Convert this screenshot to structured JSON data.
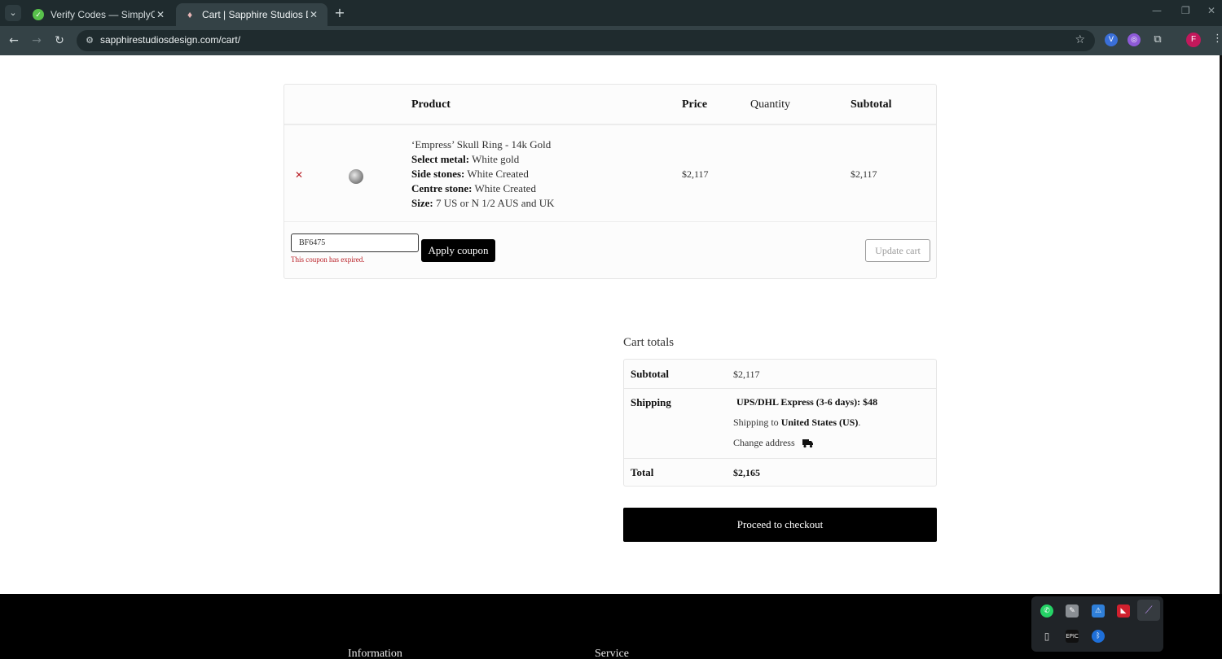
{
  "browser": {
    "tabs": [
      {
        "title": "Verify Codes — SimplyCodes",
        "active": false
      },
      {
        "title": "Cart | Sapphire Studios Design",
        "active": true
      }
    ],
    "url": "sapphirestudiosdesign.com/cart/",
    "profile_initial": "F"
  },
  "cart": {
    "headers": {
      "product": "Product",
      "price": "Price",
      "quantity": "Quantity",
      "subtotal": "Subtotal"
    },
    "item": {
      "name": "‘Empress’ Skull Ring - 14k Gold",
      "meta": [
        {
          "label": "Select metal:",
          "value": "White gold"
        },
        {
          "label": "Side stones:",
          "value": "White Created"
        },
        {
          "label": "Centre stone:",
          "value": "White Created"
        },
        {
          "label": "Size:",
          "value": "7 US or N 1/2 AUS and UK"
        }
      ],
      "price": "$2,117",
      "subtotal": "$2,117"
    },
    "coupon": {
      "value": "BF6475",
      "error": "This coupon has expired."
    },
    "apply_label": "Apply coupon",
    "update_label": "Update cart"
  },
  "totals": {
    "title": "Cart totals",
    "subtotal_label": "Subtotal",
    "subtotal_value": "$2,117",
    "shipping_label": "Shipping",
    "shipping_method": "UPS/DHL Express (3-6 days): $48",
    "shipping_to_prefix": "Shipping to",
    "shipping_to_country": "United States (US)",
    "change_address": "Change address",
    "total_label": "Total",
    "total_value": "$2,165"
  },
  "checkout_label": "Proceed to checkout",
  "footer": {
    "col1": "Information",
    "col2": "Service"
  }
}
